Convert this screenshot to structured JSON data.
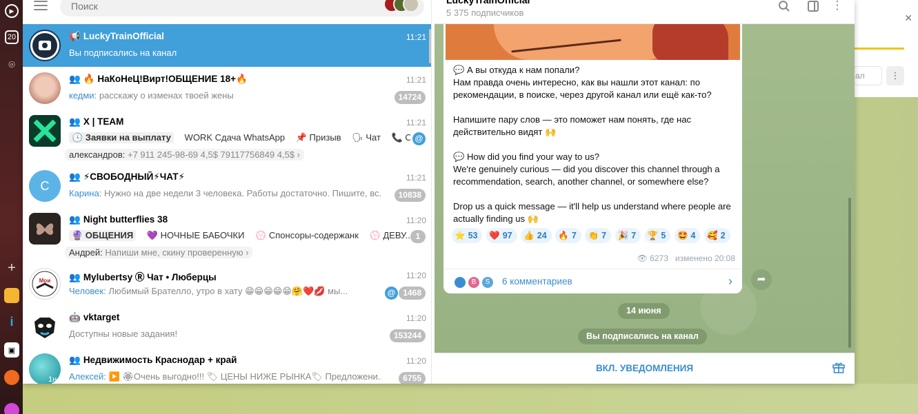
{
  "taskbar": {
    "icons": [
      "play-icon",
      "calendar-icon",
      "camera-icon",
      "plus-icon",
      "app-orange-icon",
      "app-blue-icon",
      "app-black-icon",
      "app-mail-icon",
      "app-purple-icon"
    ],
    "calendar_label": "20"
  },
  "search": {
    "placeholder": "Поиск"
  },
  "chats": [
    {
      "icon": "📢",
      "title": "LuckyTrainOfficial",
      "time": "11:21",
      "message": "Вы подписались на канал",
      "active": true
    },
    {
      "icon": "👥 🔥",
      "title": "НаКоНеЦ!Вирт!ОБЩЕНИЕ 18+🔥",
      "time": "11:21",
      "sender": "кедми:",
      "message": "расскажу о изменах твоей жены",
      "badge": "14724"
    },
    {
      "icon": "👥",
      "title": "X | TEAM",
      "time": "11:21",
      "topics": [
        "🕓 Заявки на выплату",
        "WORK Сдача WhatsApp",
        "📌 Призыв",
        "🗣 Чат",
        "📞 От..."
      ],
      "sub_sender": "александров:",
      "sub_text": "+7 911 245-98-69 4,5$ 79117756849 4,5$ ›"
    },
    {
      "icon": "👥",
      "title": "⚡СВОБОДНЫЙ⚡ЧАТ⚡",
      "time": "11:21",
      "sender": "Карина:",
      "message": "Нужно на две недели 3 человека. Работы достаточно. Пишите, вс...",
      "badge": "10838",
      "avatar_letter": "С"
    },
    {
      "icon": "👥",
      "title": "Night butterflies 38",
      "time": "11:20",
      "topics": [
        "🔮 ОБЩЕНИЯ",
        "💜 НОЧНЫЕ БАБОЧКИ",
        "💮 Спонсоры-содержанк",
        "💮 ДЕВУ..."
      ],
      "sub_sender": "Андрей:",
      "sub_text": "Напиши мне, скину проверенную ›",
      "badge": "1"
    },
    {
      "icon": "👥",
      "title": "Mylubertsy Ⓡ Чат • Люберцы",
      "time": "11:20",
      "sender": "Человек:",
      "message": "Любимый Брателло, утро в хату 😁😁😁😁😁🤗❤️💋 мы...",
      "badge": "1468"
    },
    {
      "icon": "🤖",
      "title": "vktarget",
      "time": "11:20",
      "message": "Доступны новые задания!",
      "badge": "153244"
    },
    {
      "icon": "👥",
      "title": "Недвижимость Краснодар + край",
      "time": "11:20",
      "sender": "Алексей:",
      "message": "▶️ 🏵Очень выгодно!!! 🏷 ЦЕНЫ НИЖЕ РЫНКА🏷 Предложени...",
      "badge": "6755",
      "avatar_caption": "1н"
    }
  ],
  "channel": {
    "name": "LuckyTrainOfficial",
    "subscribers": "5 375 подписчиков"
  },
  "post": {
    "paragraphs": [
      "💬 А вы откуда к нам попали?\nНам правда очень интересно, как вы нашли этот канал: по рекомендации, в поиске, через другой канал или ещё как-то?",
      "Напишите пару слов — это поможет нам понять, где нас действительно видят 🙌",
      "💬 How did you find your way to us?\nWe're genuinely curious — did you discover this channel through a recommendation, search, another channel, or somewhere else?",
      "Drop us a quick message — it'll help us understand where people are actually finding us 🙌"
    ],
    "reactions": [
      {
        "emoji": "⭐",
        "count": "53"
      },
      {
        "emoji": "❤️",
        "count": "97"
      },
      {
        "emoji": "👍",
        "count": "24"
      },
      {
        "emoji": "🔥",
        "count": "7"
      },
      {
        "emoji": "👏",
        "count": "7"
      },
      {
        "emoji": "🎉",
        "count": "7"
      },
      {
        "emoji": "🏆",
        "count": "5"
      },
      {
        "emoji": "🤩",
        "count": "4"
      },
      {
        "emoji": "🥰",
        "count": "2"
      }
    ],
    "views": "6273",
    "edited": "изменено 20:08",
    "comments_label": "6 комментариев",
    "comment_avatars": [
      "",
      "B",
      "S"
    ]
  },
  "date_pill": "14 июня",
  "service_message": "Вы подписались на канал",
  "footer": {
    "notify_label": "ВКЛ. УВЕДОМЛЕНИЯ"
  },
  "bg_window": {
    "button_text": "ал"
  }
}
